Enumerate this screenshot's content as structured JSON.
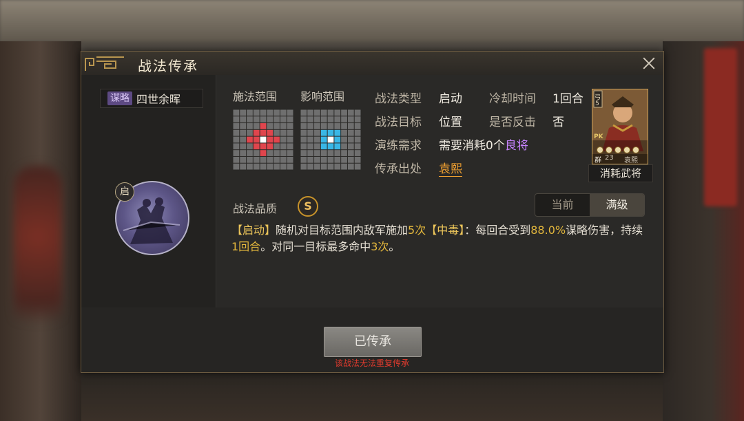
{
  "window": {
    "title": "战法传承",
    "close_label": "×"
  },
  "skill": {
    "type_tag": "谋略",
    "name": "四世余晖",
    "icon_badge": "启",
    "icon_name": "skill-portrait-icon"
  },
  "ranges": {
    "cast_label": "施法范围",
    "effect_label": "影响范围",
    "cast_color": "#e0454d",
    "effect_color": "#39b7e6"
  },
  "info": {
    "type_label": "战法类型",
    "type_value": "启动",
    "cooldown_label": "冷却时间",
    "cooldown_value": "1回合",
    "target_label": "战法目标",
    "target_value": "位置",
    "counter_label": "是否反击",
    "counter_value": "否",
    "drill_label": "演练需求",
    "drill_value_prefix": "需要消耗0个",
    "drill_value_highlight": "良将",
    "origin_label": "传承出处",
    "origin_value": "袁熙"
  },
  "card": {
    "label": "消耗武将",
    "faction": "群",
    "level": "23",
    "name": "袁熙",
    "pk_tag": "PK",
    "stars": 5,
    "side_tag": "弓",
    "rank": "5"
  },
  "quality": {
    "label": "战法品质",
    "grade": "S"
  },
  "level_toggle": {
    "current": "当前",
    "max": "满级",
    "selected": "max"
  },
  "description": {
    "p1": "【启动】",
    "p2": "随机对目标范围内敌军施加",
    "p3": "5次",
    "p4": "【中毒】",
    "p5": "：每回合受到",
    "p6": "88.0%",
    "p7": "谋略伤害，持续",
    "p8": "1回合",
    "p9": "。对同一目标最多命中",
    "p10": "3次",
    "p11": "。"
  },
  "actions": {
    "inherit_button": "已传承",
    "warning": "该战法无法重复传承"
  }
}
